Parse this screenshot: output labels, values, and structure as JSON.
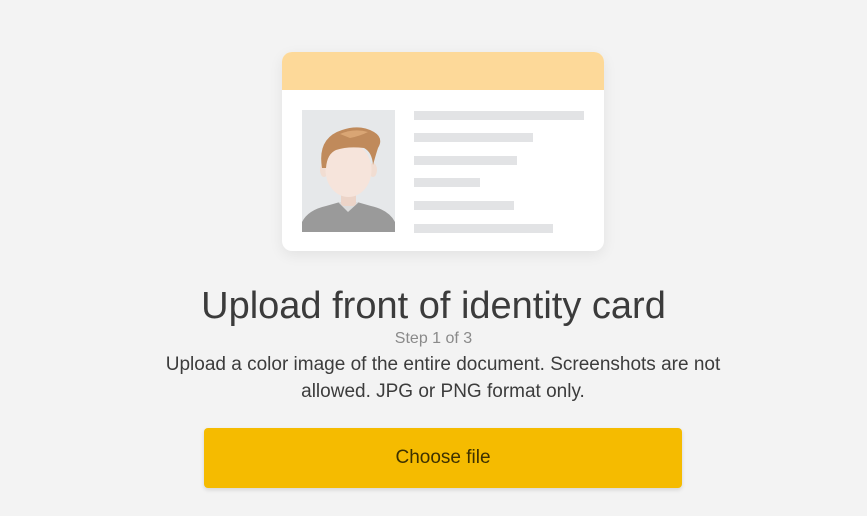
{
  "illustration": {
    "icon": "identity-card-front-illustration",
    "header_color": "#fdd999",
    "photo_background": "#e6e8ea",
    "line_color": "#e2e3e5"
  },
  "title": "Upload front of identity card",
  "step": "Step 1 of 3",
  "description": "Upload a color image of the entire document. Screenshots are not allowed. JPG or PNG format only.",
  "button": {
    "label": "Choose file",
    "color": "#f5bb00"
  }
}
